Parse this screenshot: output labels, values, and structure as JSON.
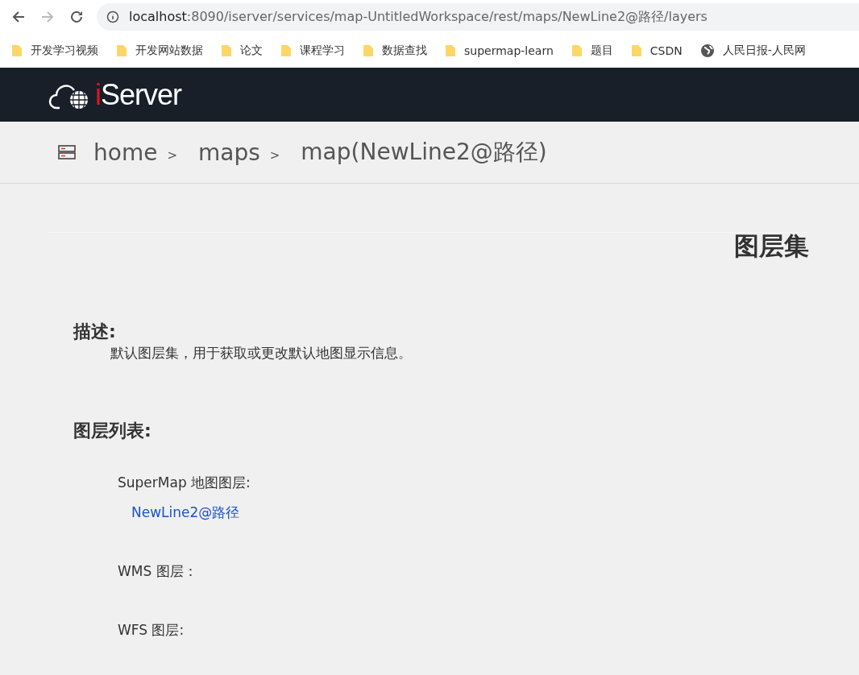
{
  "browser": {
    "url_host": "localhost",
    "url_rest": ":8090/iserver/services/map-UntitledWorkspace/rest/maps/NewLine2@路径/layers",
    "back_disabled": false,
    "forward_disabled": true
  },
  "bookmarks": [
    {
      "kind": "folder",
      "label": "开发学习视频"
    },
    {
      "kind": "folder",
      "label": "开发网站数据"
    },
    {
      "kind": "folder",
      "label": "论文"
    },
    {
      "kind": "folder",
      "label": "课程学习"
    },
    {
      "kind": "folder",
      "label": "数据查找"
    },
    {
      "kind": "folder",
      "label": "supermap-learn"
    },
    {
      "kind": "folder",
      "label": "题目"
    },
    {
      "kind": "folder",
      "label": "CSDN"
    },
    {
      "kind": "site",
      "label": "人民日报-人民网"
    }
  ],
  "header": {
    "logo_accent": "i",
    "logo_text": "Server"
  },
  "breadcrumb": [
    {
      "label": "home",
      "separator": ">"
    },
    {
      "label": "maps",
      "separator": ">"
    },
    {
      "label": "map(NewLine2@路径)"
    }
  ],
  "page": {
    "title": "图层集",
    "description": {
      "heading": "描述:",
      "text": "默认图层集，用于获取或更改默认地图显示信息。"
    },
    "layers": {
      "heading": "图层列表:",
      "groups": [
        {
          "label": "SuperMap 地图图层:",
          "links": [
            "NewLine2@路径"
          ]
        },
        {
          "label": "WMS 图层："
        },
        {
          "label": "WFS 图层:"
        }
      ]
    }
  }
}
